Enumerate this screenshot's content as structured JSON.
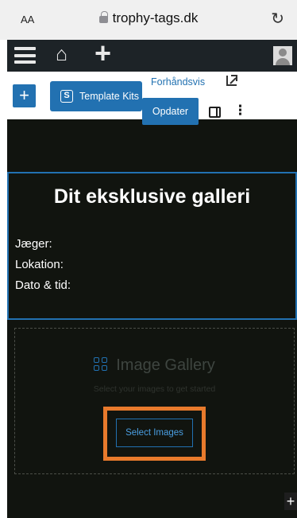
{
  "browser": {
    "text_size_label": "AA",
    "url": "trophy-tags.dk"
  },
  "icons": [
    "lock-icon",
    "reload-icon",
    "menu-icon",
    "home-icon",
    "plus-icon",
    "avatar-icon",
    "external-link-icon",
    "sidebar-toggle-icon",
    "more-options-icon",
    "gallery-grid-icon"
  ],
  "toolbar": {
    "add_block_label": "+",
    "template_kits_icon_letter": "S",
    "template_kits_label": "Template Kits",
    "preview_label": "Forhåndsvis",
    "update_label": "Opdater",
    "more_label": "⋮"
  },
  "content": {
    "heading": "Dit eksklusive galleri",
    "fields": [
      "Jæger:",
      "Lokation:",
      "Dato & tid:"
    ]
  },
  "gallery": {
    "title": "Image Gallery",
    "subtitle": "Select your images to get started",
    "button_label": "Select Images"
  },
  "inserter_label": "+",
  "colors": {
    "wp_blue": "#2271b1",
    "admin_bar": "#1d2327",
    "canvas_bg": "#11140f",
    "highlight_orange": "#e87a2c"
  }
}
